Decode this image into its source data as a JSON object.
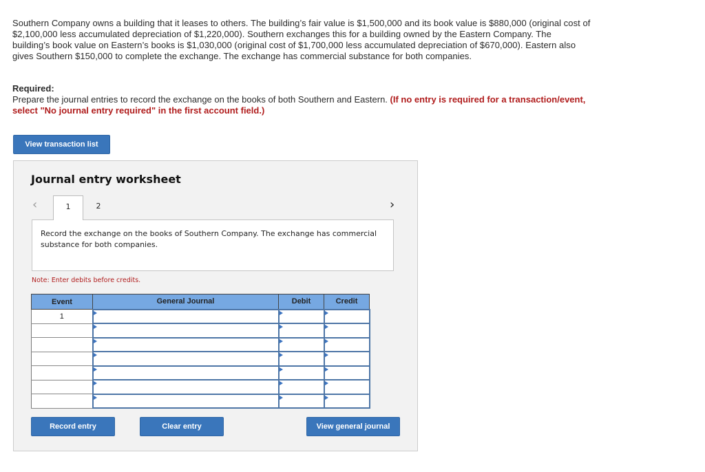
{
  "problem": {
    "text": "Southern Company owns a building that it leases to others. The building’s fair value is $1,500,000 and its book value is $880,000 (original cost of $2,100,000 less accumulated depreciation of $1,220,000). Southern exchanges this for a building owned by the Eastern Company. The building’s book value on Eastern’s books is $1,030,000 (original cost of $1,700,000 less accumulated depreciation of $670,000). Eastern also gives Southern $150,000 to complete the exchange. The exchange has commercial substance for both companies."
  },
  "required": {
    "label": "Required:",
    "instruction": "Prepare the journal entries to record the exchange on the books of both Southern and Eastern. ",
    "note_red": "(If no entry is required for a transaction/event, select \"No journal entry required\" in the first account field.)"
  },
  "buttons": {
    "view_transaction_list": "View transaction list",
    "record_entry": "Record entry",
    "clear_entry": "Clear entry",
    "view_general_journal": "View general journal"
  },
  "worksheet": {
    "title": "Journal entry worksheet",
    "prev_icon": "‹",
    "next_icon": "›",
    "tabs": [
      "1",
      "2"
    ],
    "active_tab": "1",
    "description": "Record the exchange on the books of Southern Company. The exchange has commercial substance for both companies.",
    "note": "Note: Enter debits before credits."
  },
  "table": {
    "headers": [
      "Event",
      "General Journal",
      "Debit",
      "Credit"
    ],
    "rows": [
      {
        "event": "1",
        "account": "",
        "debit": "",
        "credit": ""
      },
      {
        "event": "",
        "account": "",
        "debit": "",
        "credit": ""
      },
      {
        "event": "",
        "account": "",
        "debit": "",
        "credit": ""
      },
      {
        "event": "",
        "account": "",
        "debit": "",
        "credit": ""
      },
      {
        "event": "",
        "account": "",
        "debit": "",
        "credit": ""
      },
      {
        "event": "",
        "account": "",
        "debit": "",
        "credit": ""
      },
      {
        "event": "",
        "account": "",
        "debit": "",
        "credit": ""
      }
    ]
  },
  "colors": {
    "button_blue": "#3a76bb",
    "header_blue": "#76a8e2",
    "required_red": "#b01c1c",
    "panel_bg": "#f2f2f2"
  }
}
